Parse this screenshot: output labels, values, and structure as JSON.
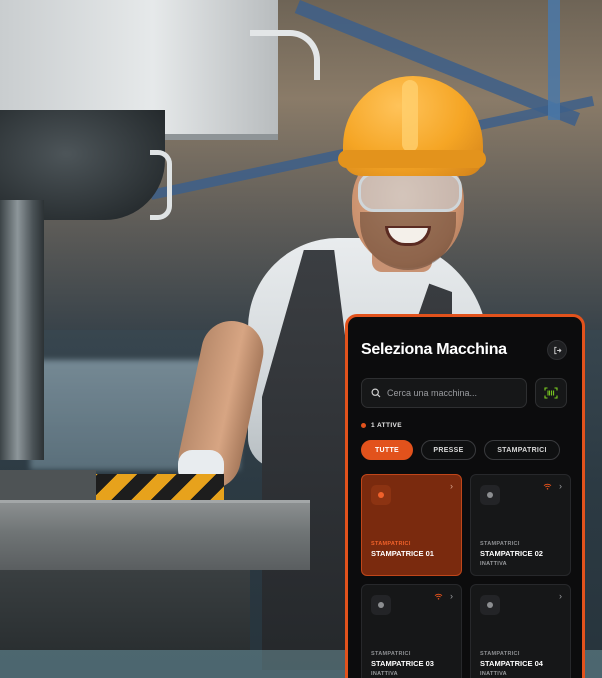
{
  "panel": {
    "title": "Seleziona Macchina",
    "logout_icon": "logout-icon",
    "search": {
      "placeholder": "Cerca una macchina...",
      "value": "",
      "icon": "search-icon"
    },
    "scan_icon": "barcode-scan-icon",
    "status": {
      "text": "1 ATTIVE",
      "dot_color": "#e2521c"
    },
    "filters": [
      {
        "label": "TUTTE",
        "active": true
      },
      {
        "label": "PRESSE",
        "active": false
      },
      {
        "label": "STAMPATRICI",
        "active": false
      }
    ],
    "machines": [
      {
        "category": "STAMPATRICI",
        "name": "STAMPATRICE 01",
        "state": "",
        "active": true,
        "wifi": false
      },
      {
        "category": "STAMPATRICI",
        "name": "STAMPATRICE 02",
        "state": "INATTIVA",
        "active": false,
        "wifi": true
      },
      {
        "category": "STAMPATRICI",
        "name": "STAMPATRICE 03",
        "state": "INATTIVA",
        "active": false,
        "wifi": true
      },
      {
        "category": "STAMPATRICI",
        "name": "STAMPATRICE 04",
        "state": "INATTIVA",
        "active": false,
        "wifi": false
      }
    ]
  },
  "colors": {
    "accent": "#e2521c",
    "panel_bg": "#0c0c0d",
    "card_bg": "#161718",
    "active_card_bg": "#7a2a0e"
  }
}
